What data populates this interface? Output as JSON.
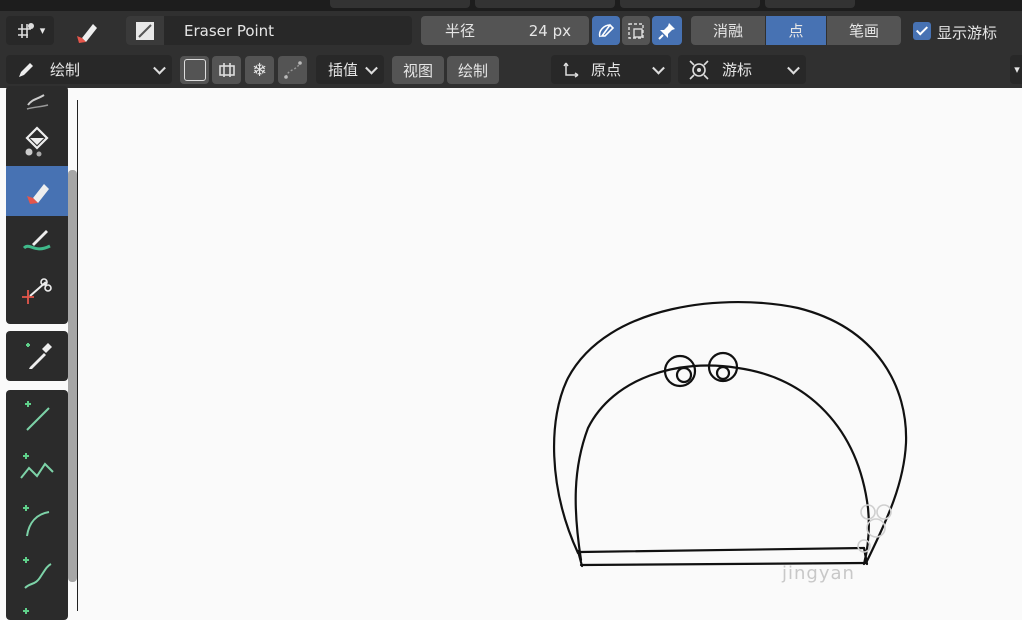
{
  "header": {
    "brush_name": "Eraser Point",
    "radius_label": "半径",
    "radius_value": "24 px",
    "mode_options": [
      "消融",
      "点",
      "笔画"
    ],
    "mode_selected": "点",
    "show_cursor_label": "显示游标"
  },
  "toolbar2": {
    "mode_label": "绘制",
    "interpolate_label": "插值",
    "view_label": "视图",
    "draw_label": "绘制",
    "origin_label": "原点",
    "cursor_label": "游标"
  },
  "tools": [
    "draw-tool",
    "fill-tool",
    "erase-tool",
    "tint-tool",
    "cutter-tool",
    "eyedropper-tool",
    "line-tool",
    "polyline-tool",
    "arc-tool",
    "curve-tool"
  ],
  "active_tool": "erase-tool",
  "watermark": "jingyan",
  "colors": {
    "accent": "#4772b3",
    "panel": "#303030",
    "button": "#545454",
    "canvas": "#fafafa"
  }
}
